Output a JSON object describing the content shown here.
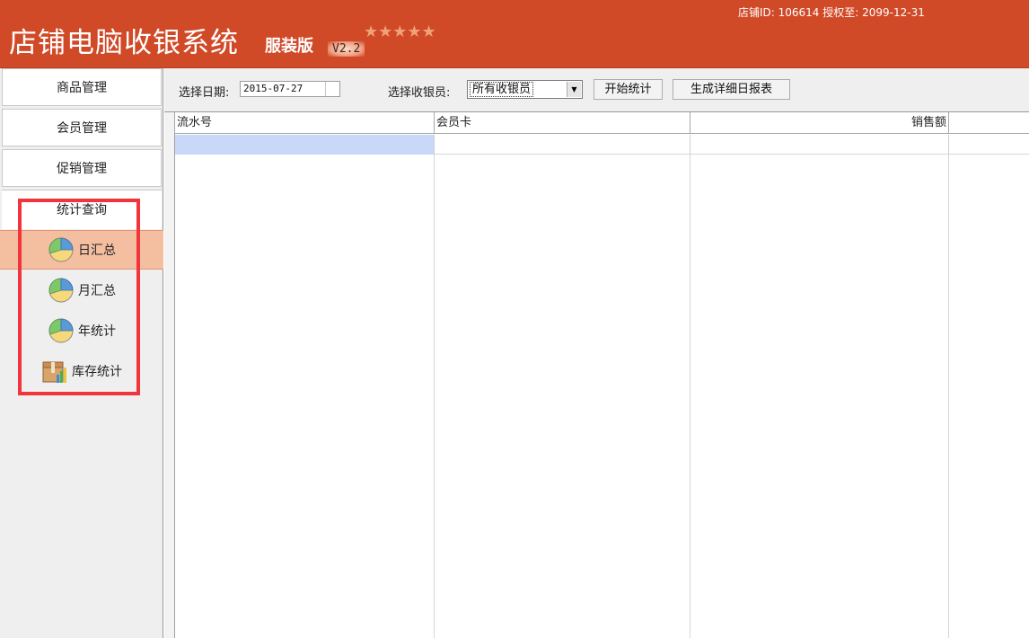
{
  "header": {
    "title": "店铺电脑收银系统",
    "edition": "服装版",
    "version": "V2.2",
    "stars": "★★★★★",
    "store_info": "店铺ID: 106614 授权至: 2099-12-31"
  },
  "sidebar": {
    "items": [
      {
        "label": "商品管理"
      },
      {
        "label": "会员管理"
      },
      {
        "label": "促销管理"
      }
    ],
    "stats_section": {
      "title": "统计查询",
      "items": [
        {
          "label": "日汇总",
          "icon": "pie-chart-icon",
          "active": true
        },
        {
          "label": "月汇总",
          "icon": "pie-chart-icon",
          "active": false
        },
        {
          "label": "年统计",
          "icon": "pie-chart-icon",
          "active": false
        },
        {
          "label": "库存统计",
          "icon": "inventory-chart-icon",
          "active": false
        }
      ]
    }
  },
  "toolbar": {
    "date_label": "选择日期:",
    "date_value": "2015-07-27",
    "cashier_label": "选择收银员:",
    "cashier_selected": "所有收银员",
    "start_button": "开始统计",
    "report_button": "生成详细日报表"
  },
  "grid": {
    "columns": [
      "流水号",
      "会员卡",
      "销售额"
    ]
  },
  "colors": {
    "header_bg": "#d14a28",
    "active_item_bg": "#f4bea1",
    "highlight_box": "#f2343c",
    "selected_cell": "#c9d7f8"
  }
}
